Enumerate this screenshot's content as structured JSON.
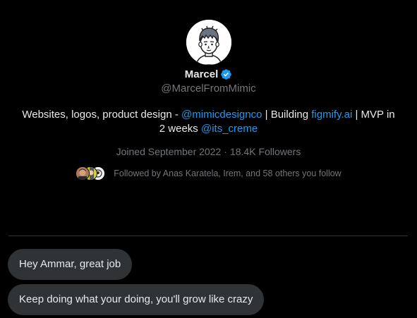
{
  "profile": {
    "name": "Marcel",
    "handle": "@MarcelFromMimic",
    "verified": true,
    "bio": {
      "part1": "Websites, logos, product design - ",
      "mention1": "@mimicdesignco",
      "part2": " | Building ",
      "link1": "figmify.ai",
      "part3": " | MVP in 2 weeks ",
      "mention2": "@its_creme"
    },
    "joined": "Joined September 2022",
    "separator": "·",
    "followers": "18.4K Followers",
    "followed_by": "Followed by Anas Karatela, Irem, and 58 others you follow"
  },
  "messages": [
    {
      "text": "Hey Ammar, great job"
    },
    {
      "text": "Keep doing what your doing, you'll grow like crazy"
    }
  ],
  "colors": {
    "background": "#000000",
    "text_primary": "#e7e9ea",
    "text_secondary": "#71767b",
    "link": "#1d9bf0",
    "bubble": "#2f3336",
    "divider": "#2f3336",
    "verified": "#1d9bf0"
  },
  "icons": {
    "verified": "verified-badge-icon"
  }
}
